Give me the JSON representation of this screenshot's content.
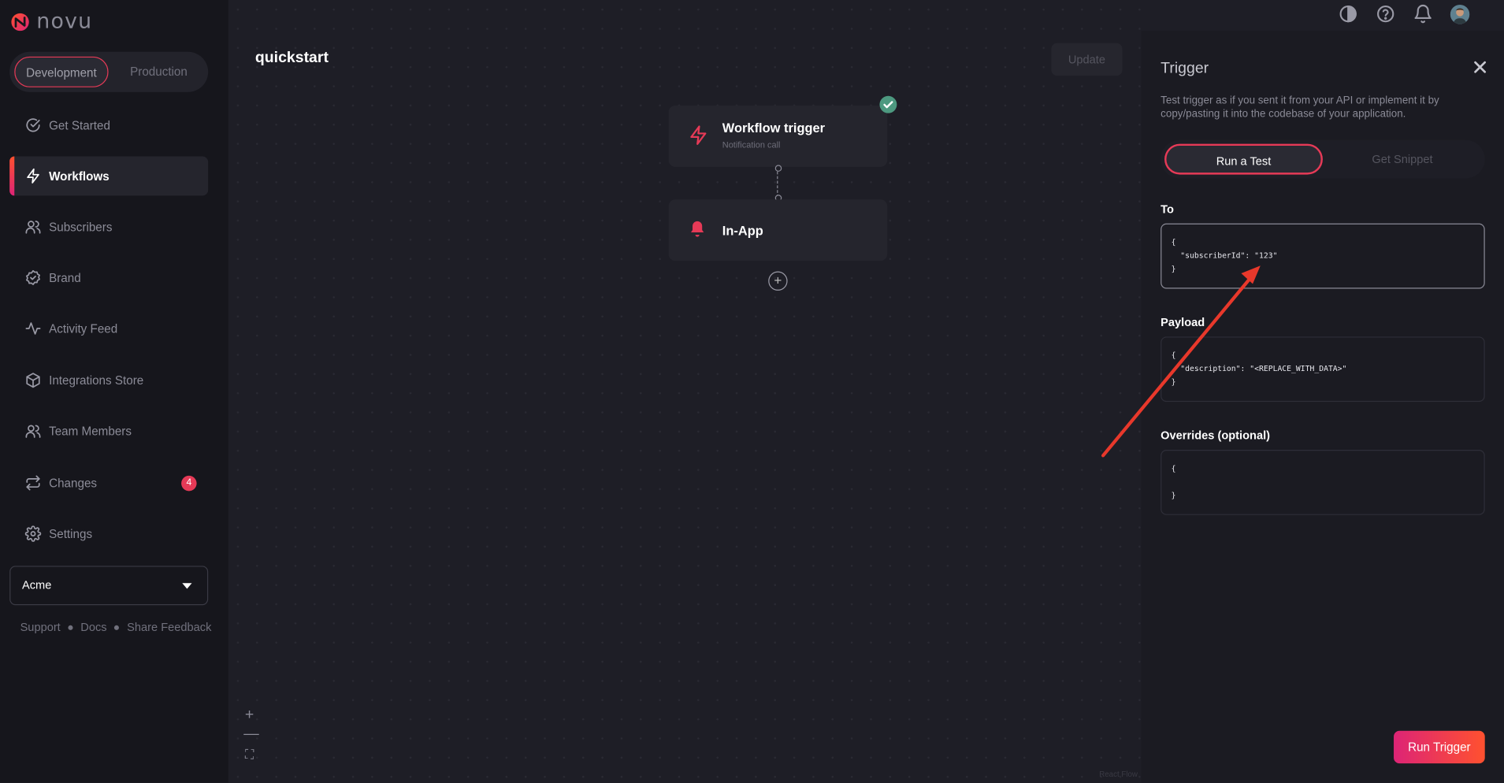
{
  "app": {
    "name": "novu"
  },
  "environment": {
    "options": [
      "Development",
      "Production"
    ],
    "selected": "Development"
  },
  "sidebar": {
    "items": [
      {
        "label": "Get Started",
        "icon": "check-circle-icon"
      },
      {
        "label": "Workflows",
        "icon": "bolt-icon",
        "active": true
      },
      {
        "label": "Subscribers",
        "icon": "users-icon"
      },
      {
        "label": "Brand",
        "icon": "badge-check-icon"
      },
      {
        "label": "Activity Feed",
        "icon": "activity-icon"
      },
      {
        "label": "Integrations Store",
        "icon": "box-icon"
      },
      {
        "label": "Team Members",
        "icon": "users-icon"
      },
      {
        "label": "Changes",
        "icon": "repeat-icon",
        "badge": "4"
      },
      {
        "label": "Settings",
        "icon": "gear-icon"
      }
    ],
    "organization": "Acme",
    "footer_links": [
      "Support",
      "Docs",
      "Share Feedback"
    ]
  },
  "workflow": {
    "name": "quickstart",
    "update_label": "Update",
    "nodes": [
      {
        "title": "Workflow trigger",
        "subtitle": "Notification call",
        "icon": "bolt-icon"
      },
      {
        "title": "In-App",
        "icon": "bell-icon"
      }
    ],
    "zoom_controls": [
      "+",
      "—",
      "⛶"
    ],
    "attribution": "React Flow"
  },
  "topbar": {
    "icons": [
      "theme-toggle-icon",
      "help-icon",
      "bell-icon",
      "user-avatar"
    ]
  },
  "trigger_panel": {
    "title": "Trigger",
    "description": "Test trigger as if you sent it from your API or implement it by copy/pasting it into the codebase of your application.",
    "tabs": [
      "Run a Test",
      "Get Snippet"
    ],
    "active_tab": "Run a Test",
    "to": {
      "label": "To",
      "value": "{\n  \"subscriberId\": \"123\"\n}"
    },
    "payload": {
      "label": "Payload",
      "value": "{\n  \"description\": \"<REPLACE_WITH_DATA>\"\n}"
    },
    "overrides": {
      "label": "Overrides (optional)",
      "value": "{\n\n}"
    },
    "run_label": "Run Trigger"
  },
  "colors": {
    "accent": "#e63a57",
    "success": "#4d9980",
    "background": "#1e1e26",
    "sidebar": "#16161c"
  }
}
